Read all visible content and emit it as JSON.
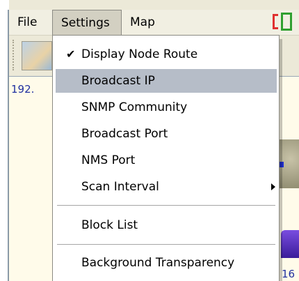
{
  "menubar": {
    "file": "File",
    "settings": "Settings",
    "map": "Map"
  },
  "map": {
    "left_label": "192.",
    "bottom_label": "16"
  },
  "settings_menu": {
    "items": [
      {
        "label": "Display Node Route",
        "checked": true,
        "check_glyph": "✔",
        "highlighted": false
      },
      {
        "label": "Broadcast IP",
        "checked": false,
        "highlighted": true
      },
      {
        "label": "SNMP Community",
        "checked": false,
        "highlighted": false
      },
      {
        "label": "Broadcast Port",
        "checked": false,
        "highlighted": false
      },
      {
        "label": "NMS Port",
        "checked": false,
        "highlighted": false
      },
      {
        "label": "Scan Interval",
        "checked": false,
        "highlighted": false,
        "submenu": true
      },
      {
        "label": "Block List",
        "checked": false,
        "highlighted": false
      },
      {
        "label": "Background Transparency",
        "checked": false,
        "highlighted": false
      }
    ]
  },
  "colors": {
    "menubar_bg": "#f1efe2",
    "highlight": "#b6bdc8",
    "dropdown_bg": "#ffffff",
    "map_bg": "#fffbea"
  },
  "icons": [
    "checkmark-icon",
    "submenu-arrow-icon",
    "map-toolbar-icon"
  ]
}
